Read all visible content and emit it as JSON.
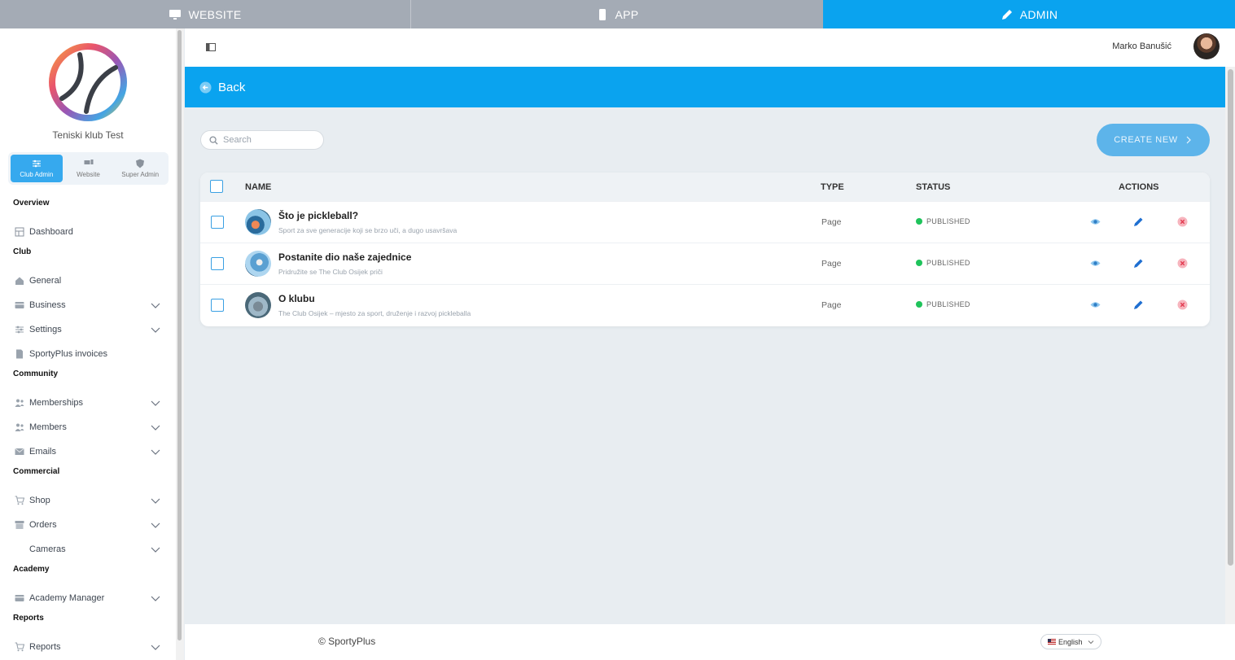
{
  "top_tabs": [
    {
      "label": "WEBSITE",
      "icon": "monitor-icon"
    },
    {
      "label": "APP",
      "icon": "phone-icon"
    },
    {
      "label": "ADMIN",
      "icon": "pencil-icon",
      "active": true
    }
  ],
  "colors": {
    "accent": "#0aa3ef",
    "create_button": "#5db4ea",
    "published": "#1fc35b",
    "delete": "#f06b7c"
  },
  "sidebar": {
    "club_name": "Teniski klub Test",
    "roles": [
      {
        "label": "Club Admin",
        "icon": "sliders-icon",
        "active": true
      },
      {
        "label": "Website",
        "icon": "website-icon"
      },
      {
        "label": "Super Admin",
        "icon": "shield-icon"
      }
    ],
    "sections": [
      {
        "title": "Overview",
        "items": [
          {
            "label": "Dashboard",
            "icon": "dashboard-icon",
            "expandable": false
          }
        ]
      },
      {
        "title": "Club",
        "items": [
          {
            "label": "General",
            "icon": "home-icon",
            "expandable": false
          },
          {
            "label": "Business",
            "icon": "card-icon",
            "expandable": true
          },
          {
            "label": "Settings",
            "icon": "sliders-icon",
            "expandable": true
          },
          {
            "label": "SportyPlus invoices",
            "icon": "invoice-icon",
            "expandable": false
          }
        ]
      },
      {
        "title": "Community",
        "items": [
          {
            "label": "Memberships",
            "icon": "users-icon",
            "expandable": true
          },
          {
            "label": "Members",
            "icon": "users-icon",
            "expandable": true
          },
          {
            "label": "Emails",
            "icon": "mail-icon",
            "expandable": true
          }
        ]
      },
      {
        "title": "Commercial",
        "items": [
          {
            "label": "Shop",
            "icon": "cart-icon",
            "expandable": true
          },
          {
            "label": "Orders",
            "icon": "orders-icon",
            "expandable": true
          },
          {
            "label": "Cameras",
            "icon": "",
            "expandable": true
          }
        ]
      },
      {
        "title": "Academy",
        "items": [
          {
            "label": "Academy Manager",
            "icon": "card-icon",
            "expandable": true
          }
        ]
      },
      {
        "title": "Reports",
        "items": [
          {
            "label": "Reports",
            "icon": "cart-icon",
            "expandable": true
          }
        ]
      }
    ]
  },
  "header": {
    "user_name": "Marko Banušić"
  },
  "back_label": "Back",
  "search": {
    "placeholder": "Search",
    "value": ""
  },
  "create_label": "CREATE NEW",
  "table": {
    "columns": {
      "name": "NAME",
      "type": "TYPE",
      "status": "STATUS",
      "actions": "ACTIONS"
    },
    "rows": [
      {
        "title": "Što je pickleball?",
        "subtitle": "Sport za sve generacije koji se brzo uči, a dugo usavršava",
        "type": "Page",
        "status": "PUBLISHED"
      },
      {
        "title": "Postanite dio naše zajednice",
        "subtitle": "Pridružite se The Club Osijek priči",
        "type": "Page",
        "status": "PUBLISHED"
      },
      {
        "title": "O klubu",
        "subtitle": "The Club Osijek – mjesto za sport, druženje i razvoj pickleballa",
        "type": "Page",
        "status": "PUBLISHED"
      }
    ]
  },
  "footer": {
    "copyright": "© SportyPlus",
    "language": "English"
  }
}
